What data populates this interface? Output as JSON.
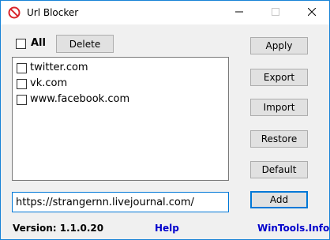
{
  "window": {
    "title": "Url Blocker",
    "icon": "prohibited-icon",
    "controls": [
      "minimize-icon",
      "maximize-icon",
      "close-icon"
    ]
  },
  "toolbar": {
    "all_label": "All",
    "all_checked": false,
    "delete_label": "Delete"
  },
  "sites": [
    {
      "label": "twitter.com",
      "checked": false
    },
    {
      "label": "vk.com",
      "checked": false
    },
    {
      "label": "www.facebook.com",
      "checked": false
    }
  ],
  "actions": {
    "apply_label": "Apply",
    "export_label": "Export",
    "import_label": "Import",
    "restore_label": "Restore",
    "default_label": "Default",
    "add_label": "Add"
  },
  "url_input": {
    "value": "https://strangernn.livejournal.com/"
  },
  "footer": {
    "version": "Version: 1.1.0.20",
    "help": "Help",
    "site": "WinTools.Info",
    "link_color": "#0000cc"
  },
  "colors": {
    "accent": "#0078d7",
    "icon_red": "#d9262c"
  }
}
